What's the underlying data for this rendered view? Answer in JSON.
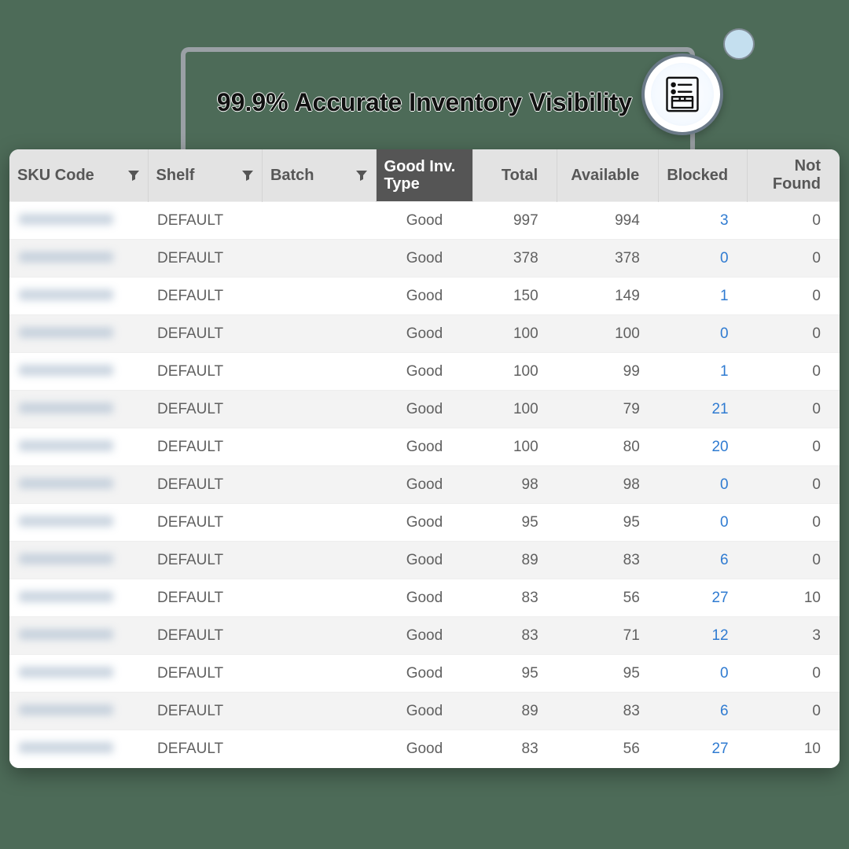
{
  "callout": {
    "title": "99.9% Accurate Inventory Visibility",
    "icon": "inventory-list-icon"
  },
  "table": {
    "columns": {
      "sku": {
        "label": "SKU Code",
        "filterable": true,
        "active": false
      },
      "shelf": {
        "label": "Shelf",
        "filterable": true,
        "active": false
      },
      "batch": {
        "label": "Batch",
        "filterable": true,
        "active": false
      },
      "type": {
        "label": "Good Inv. Type",
        "filterable": false,
        "active": true
      },
      "total": {
        "label": "Total",
        "filterable": false,
        "active": false
      },
      "available": {
        "label": "Available",
        "filterable": false,
        "active": false
      },
      "blocked": {
        "label": "Blocked",
        "filterable": false,
        "active": false
      },
      "notfound": {
        "label": "Not Found",
        "filterable": false,
        "active": false
      }
    },
    "rows": [
      {
        "shelf": "DEFAULT",
        "batch": "",
        "type": "Good",
        "total": 997,
        "available": 994,
        "blocked": 3,
        "notfound": 0
      },
      {
        "shelf": "DEFAULT",
        "batch": "",
        "type": "Good",
        "total": 378,
        "available": 378,
        "blocked": 0,
        "notfound": 0
      },
      {
        "shelf": "DEFAULT",
        "batch": "",
        "type": "Good",
        "total": 150,
        "available": 149,
        "blocked": 1,
        "notfound": 0
      },
      {
        "shelf": "DEFAULT",
        "batch": "",
        "type": "Good",
        "total": 100,
        "available": 100,
        "blocked": 0,
        "notfound": 0
      },
      {
        "shelf": "DEFAULT",
        "batch": "",
        "type": "Good",
        "total": 100,
        "available": 99,
        "blocked": 1,
        "notfound": 0
      },
      {
        "shelf": "DEFAULT",
        "batch": "",
        "type": "Good",
        "total": 100,
        "available": 79,
        "blocked": 21,
        "notfound": 0
      },
      {
        "shelf": "DEFAULT",
        "batch": "",
        "type": "Good",
        "total": 100,
        "available": 80,
        "blocked": 20,
        "notfound": 0
      },
      {
        "shelf": "DEFAULT",
        "batch": "",
        "type": "Good",
        "total": 98,
        "available": 98,
        "blocked": 0,
        "notfound": 0
      },
      {
        "shelf": "DEFAULT",
        "batch": "",
        "type": "Good",
        "total": 95,
        "available": 95,
        "blocked": 0,
        "notfound": 0
      },
      {
        "shelf": "DEFAULT",
        "batch": "",
        "type": "Good",
        "total": 89,
        "available": 83,
        "blocked": 6,
        "notfound": 0
      },
      {
        "shelf": "DEFAULT",
        "batch": "",
        "type": "Good",
        "total": 83,
        "available": 56,
        "blocked": 27,
        "notfound": 10
      },
      {
        "shelf": "DEFAULT",
        "batch": "",
        "type": "Good",
        "total": 83,
        "available": 71,
        "blocked": 12,
        "notfound": 3
      },
      {
        "shelf": "DEFAULT",
        "batch": "",
        "type": "Good",
        "total": 95,
        "available": 95,
        "blocked": 0,
        "notfound": 0
      },
      {
        "shelf": "DEFAULT",
        "batch": "",
        "type": "Good",
        "total": 89,
        "available": 83,
        "blocked": 6,
        "notfound": 0
      },
      {
        "shelf": "DEFAULT",
        "batch": "",
        "type": "Good",
        "total": 83,
        "available": 56,
        "blocked": 27,
        "notfound": 10
      }
    ]
  },
  "colors": {
    "link": "#2f7bd1",
    "header_active_bg": "#555555",
    "header_bg": "#e3e3e3"
  }
}
